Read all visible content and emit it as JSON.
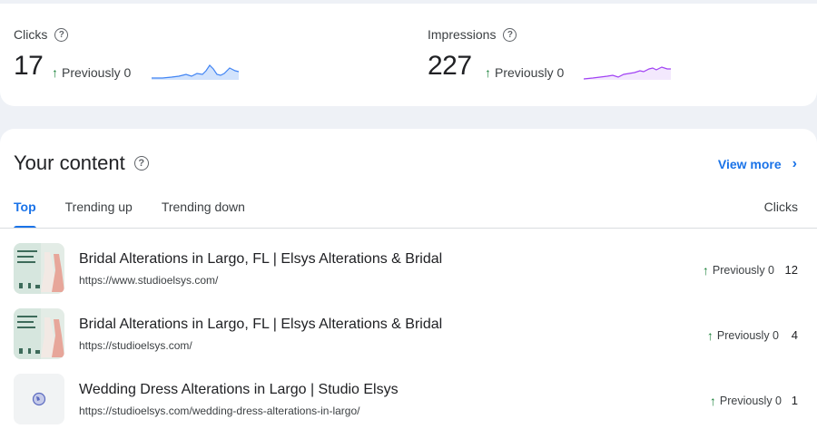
{
  "metrics": {
    "clicks": {
      "label": "Clicks",
      "value": "17",
      "previous": "Previously 0",
      "color": "#4285f4"
    },
    "impressions": {
      "label": "Impressions",
      "value": "227",
      "previous": "Previously 0",
      "color": "#9334e6"
    }
  },
  "content": {
    "title": "Your content",
    "view_more": "View more",
    "tabs": [
      {
        "label": "Top",
        "active": true
      },
      {
        "label": "Trending up",
        "active": false
      },
      {
        "label": "Trending down",
        "active": false
      }
    ],
    "column_header": "Clicks",
    "rows": [
      {
        "title": "Bridal Alterations in Largo, FL | Elsys Alterations & Bridal",
        "url": "https://www.studioelsys.com/",
        "previous": "Previously 0",
        "count": "12",
        "thumb": "bridal-thumbnail"
      },
      {
        "title": "Bridal Alterations in Largo, FL | Elsys Alterations & Bridal",
        "url": "https://studioelsys.com/",
        "previous": "Previously 0",
        "count": "4",
        "thumb": "bridal-thumbnail"
      },
      {
        "title": "Wedding Dress Alterations in Largo | Studio Elsys",
        "url": "https://studioelsys.com/wedding-dress-alterations-in-largo/",
        "previous": "Previously 0",
        "count": "1",
        "thumb": "globe-icon"
      }
    ]
  },
  "colors": {
    "accent": "#1a73e8",
    "up": "#188038"
  }
}
